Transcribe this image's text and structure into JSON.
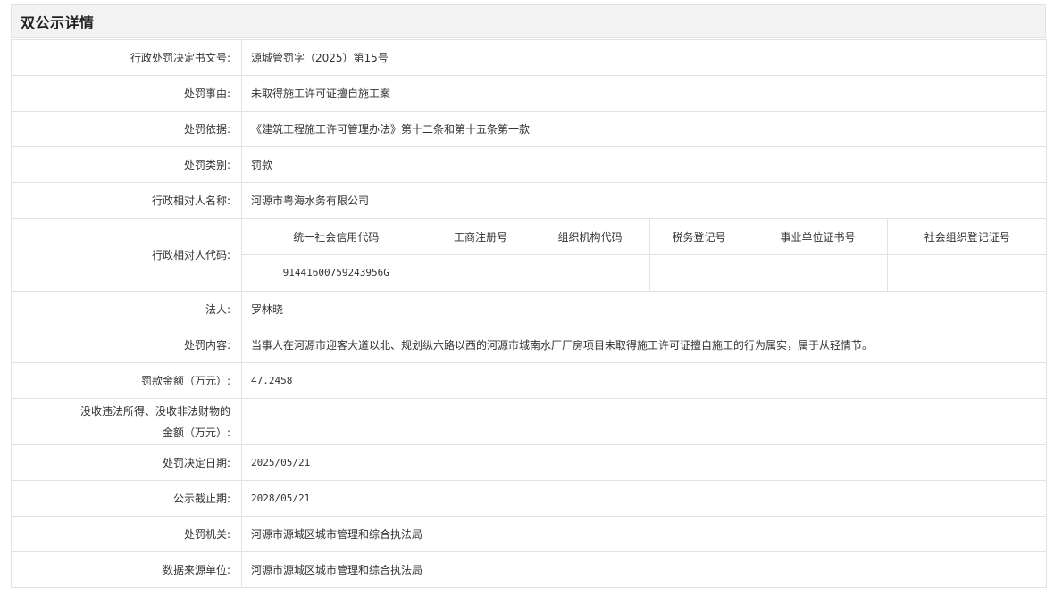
{
  "header": {
    "title": "双公示详情"
  },
  "rows": {
    "doc_no": {
      "label": "行政处罚决定书文号:",
      "value": "源城管罚字（2025）第15号"
    },
    "reason": {
      "label": "处罚事由:",
      "value": "未取得施工许可证擅自施工案"
    },
    "basis": {
      "label": "处罚依据:",
      "value": "《建筑工程施工许可管理办法》第十二条和第十五条第一款"
    },
    "category": {
      "label": "处罚类别:",
      "value": "罚款"
    },
    "party_name": {
      "label": "行政相对人名称:",
      "value": "河源市粤海水务有限公司"
    },
    "party_code": {
      "label": "行政相对人代码:"
    },
    "legal_person": {
      "label": "法人:",
      "value": "罗林晓"
    },
    "content": {
      "label": "处罚内容:",
      "value": "当事人在河源市迎客大道以北、规划纵六路以西的河源市城南水厂厂房项目未取得施工许可证擅自施工的行为属实，属于从轻情节。"
    },
    "fine_amount": {
      "label": "罚款金额（万元）:",
      "value": "47.2458"
    },
    "confiscation": {
      "label_line1": "没收违法所得、没收非法财物的",
      "label_line2": "金额（万元）:",
      "value": ""
    },
    "decision_date": {
      "label": "处罚决定日期:",
      "value": "2025/05/21"
    },
    "publish_end": {
      "label": "公示截止期:",
      "value": "2028/05/21"
    },
    "authority": {
      "label": "处罚机关:",
      "value": "河源市源城区城市管理和综合执法局"
    },
    "data_source": {
      "label": "数据来源单位:",
      "value": "河源市源城区城市管理和综合执法局"
    }
  },
  "codes": {
    "headers": [
      "统一社会信用代码",
      "工商注册号",
      "组织机构代码",
      "税务登记号",
      "事业单位证书号",
      "社会组织登记证号"
    ],
    "values": [
      "91441600759243956G",
      "",
      "",
      "",
      "",
      ""
    ]
  }
}
